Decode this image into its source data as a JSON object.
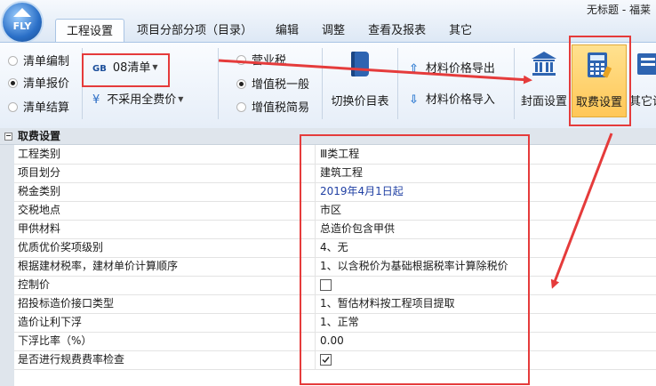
{
  "window": {
    "title": "无标题 - 福莱"
  },
  "logo": {
    "text": "FLY"
  },
  "tabs": [
    "工程设置",
    "项目分部分项（目录）",
    "编辑",
    "调整",
    "查看及报表",
    "其它"
  ],
  "active_tab": "工程设置",
  "ribbon": {
    "bill_modes": [
      "清单编制",
      "清单报价",
      "清单结算"
    ],
    "selected_bill_mode": "清单报价",
    "bill_standard": "08清单",
    "bill_standard_badge": "GB",
    "fee_option": "不采用全费价",
    "tax_modes": [
      "营业税",
      "增值税一般",
      "增值税简易"
    ],
    "selected_tax_mode": "增值税一般",
    "switch_price_catalog": "切换价目表",
    "export_material_price": "材料价格导出",
    "import_material_price": "材料价格导入",
    "cover_settings": "封面设置",
    "fee_settings": "取费设置",
    "other_settings": "其它设"
  },
  "property_grid": {
    "section_title": "取费设置",
    "rows": [
      {
        "label": "工程类别",
        "value": "Ⅲ类工程"
      },
      {
        "label": "项目划分",
        "value": "建筑工程"
      },
      {
        "label": "税金类别",
        "value": "2019年4月1日起"
      },
      {
        "label": "交税地点",
        "value": "市区"
      },
      {
        "label": "甲供材料",
        "value": "总造价包含甲供"
      },
      {
        "label": "优质优价奖项级别",
        "value": "4、无"
      },
      {
        "label": "根据建材税率，建材单价计算顺序",
        "value": "1、以含税价为基础根据税率计算除税价"
      },
      {
        "label": "控制价",
        "value": "",
        "checked": false
      },
      {
        "label": "招投标造价接口类型",
        "value": "1、暂估材料按工程项目提取"
      },
      {
        "label": "造价让利下浮",
        "value": "1、正常"
      },
      {
        "label": "下浮比率（%）",
        "value": "0.00"
      },
      {
        "label": "是否进行规费费率检查",
        "value": "",
        "checked": true
      }
    ]
  },
  "colors": {
    "annotation": "#e53b3b",
    "date_value": "#1f3fa3"
  }
}
